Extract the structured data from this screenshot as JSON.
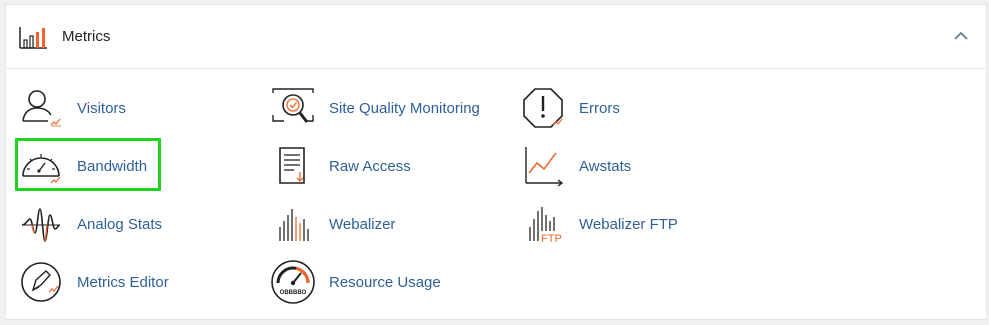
{
  "section": {
    "title": "Metrics"
  },
  "accent_color": "#f2652a",
  "highlight_color": "#21d11f",
  "items": [
    {
      "label": "Visitors"
    },
    {
      "label": "Site Quality Monitoring"
    },
    {
      "label": "Errors"
    },
    {
      "label": "Bandwidth"
    },
    {
      "label": "Raw Access"
    },
    {
      "label": "Awstats"
    },
    {
      "label": "Analog Stats"
    },
    {
      "label": "Webalizer"
    },
    {
      "label": "Webalizer FTP",
      "icon_text": "FTP"
    },
    {
      "label": "Metrics Editor"
    },
    {
      "label": "Resource Usage",
      "icon_text": "OBBBBO"
    }
  ]
}
